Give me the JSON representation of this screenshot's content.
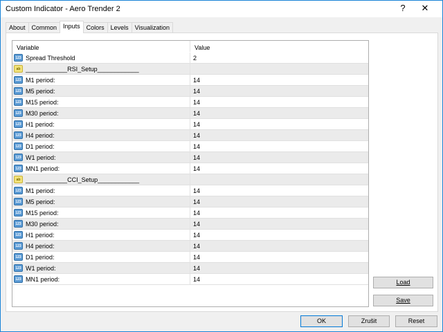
{
  "window": {
    "title": "Custom Indicator - Aero Trender 2",
    "help": "?",
    "close": "✕"
  },
  "tabs": [
    "About",
    "Common",
    "Inputs",
    "Colors",
    "Levels",
    "Visualization"
  ],
  "table": {
    "headers": {
      "variable": "Variable",
      "value": "Value"
    },
    "rows": [
      {
        "type": "num",
        "name": "Spread Threshold",
        "value": "2"
      },
      {
        "type": "str",
        "name": "____________RSI_Setup____________",
        "value": ""
      },
      {
        "type": "num",
        "name": "M1 period:",
        "value": "14"
      },
      {
        "type": "num",
        "name": "M5 period:",
        "value": "14"
      },
      {
        "type": "num",
        "name": "M15 period:",
        "value": "14"
      },
      {
        "type": "num",
        "name": "M30 period:",
        "value": "14"
      },
      {
        "type": "num",
        "name": "H1 period:",
        "value": "14"
      },
      {
        "type": "num",
        "name": "H4 period:",
        "value": "14"
      },
      {
        "type": "num",
        "name": "D1 period:",
        "value": "14"
      },
      {
        "type": "num",
        "name": "W1 period:",
        "value": "14"
      },
      {
        "type": "num",
        "name": "MN1 period:",
        "value": "14"
      },
      {
        "type": "str",
        "name": "____________CCI_Setup____________",
        "value": ""
      },
      {
        "type": "num",
        "name": "M1 period:",
        "value": "14"
      },
      {
        "type": "num",
        "name": "M5 period:",
        "value": "14"
      },
      {
        "type": "num",
        "name": "M15 period:",
        "value": "14"
      },
      {
        "type": "num",
        "name": "M30 period:",
        "value": "14"
      },
      {
        "type": "num",
        "name": "H1 period:",
        "value": "14"
      },
      {
        "type": "num",
        "name": "H4 period:",
        "value": "14"
      },
      {
        "type": "num",
        "name": "D1 period:",
        "value": "14"
      },
      {
        "type": "num",
        "name": "W1 period:",
        "value": "14"
      },
      {
        "type": "num",
        "name": "MN1 period:",
        "value": "14"
      }
    ]
  },
  "icons": {
    "num": "123",
    "str": "ab"
  },
  "buttons": {
    "load": "Load",
    "save": "Save",
    "ok": "OK",
    "cancel": "Zrušit",
    "reset": "Reset"
  }
}
